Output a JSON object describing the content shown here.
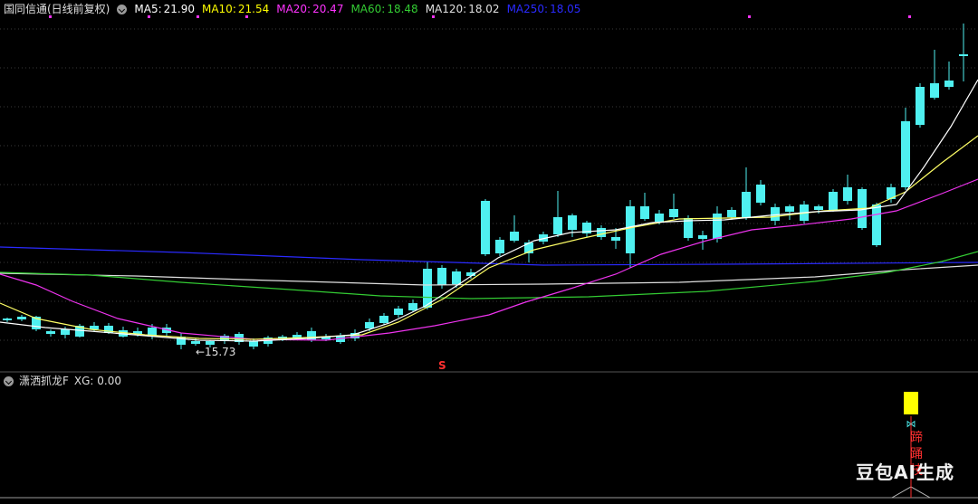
{
  "header": {
    "title": "国同信通(日线前复权)",
    "ma": [
      {
        "label": "MA5:",
        "value": "21.90",
        "color": "#ffffff"
      },
      {
        "label": "MA10:",
        "value": "21.54",
        "color": "#ffff00"
      },
      {
        "label": "MA20:",
        "value": "20.47",
        "color": "#ff33ff"
      },
      {
        "label": "MA60:",
        "value": "18.48",
        "color": "#33cc33"
      },
      {
        "label": "MA120:",
        "value": "18.02",
        "color": "#e0e0e0"
      },
      {
        "label": "MA250:",
        "value": "18.05",
        "color": "#2a2aff"
      }
    ]
  },
  "price_chart": {
    "low_annotation": "←15.73",
    "s_marker": "S",
    "colors": {
      "up": "#ff3030",
      "down": "#4ff0f0",
      "grid": "#3a3a3a",
      "ma5": "#ffffff",
      "ma10": "#ffff66",
      "ma20": "#ee33ee",
      "ma60": "#33cc33",
      "ma120": "#e0e0e0",
      "ma250": "#2a2aff"
    }
  },
  "indicator": {
    "title": "潇洒抓龙F",
    "xg_label": "XG: 0.00",
    "signal_text": "蹄踊枝",
    "signal_color": "#ff3030",
    "bar_color": "#ffff00"
  },
  "watermark": "豆包AI生成"
}
